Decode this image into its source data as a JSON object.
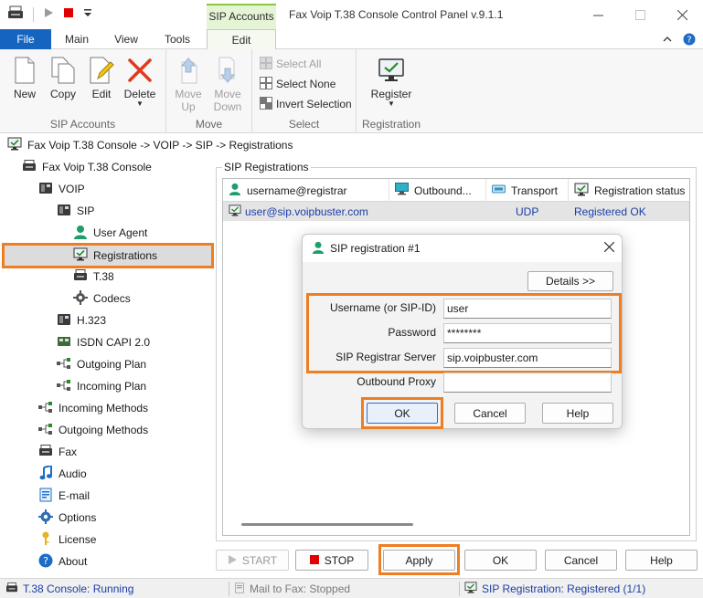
{
  "window": {
    "title": "Fax Voip T.38 Console Control Panel v.9.1.1",
    "context_tab_group": "SIP Accounts"
  },
  "ribbon": {
    "tabs": [
      "File",
      "Main",
      "View",
      "Tools",
      "Edit"
    ],
    "active_tab": "Edit",
    "groups": {
      "sip_accounts": {
        "label": "SIP Accounts",
        "new": "New",
        "copy": "Copy",
        "edit": "Edit",
        "delete": "Delete"
      },
      "move": {
        "label": "Move",
        "move_up_1": "Move",
        "move_up_2": "Up",
        "move_down_1": "Move",
        "move_down_2": "Down"
      },
      "select": {
        "label": "Select",
        "select_all": "Select All",
        "select_none": "Select None",
        "invert": "Invert Selection"
      },
      "registration": {
        "label": "Registration",
        "register": "Register"
      }
    }
  },
  "breadcrumb": "Fax Voip T.38 Console -> VOIP -> SIP -> Registrations",
  "tree": {
    "root": "Fax Voip T.38 Console",
    "voip": "VOIP",
    "sip": "SIP",
    "user_agent": "User Agent",
    "registrations": "Registrations",
    "t38": "T.38",
    "codecs": "Codecs",
    "h323": "H.323",
    "isdn": "ISDN CAPI 2.0",
    "outgoing_plan": "Outgoing Plan",
    "incoming_plan": "Incoming Plan",
    "incoming_methods": "Incoming Methods",
    "outgoing_methods": "Outgoing Methods",
    "fax": "Fax",
    "audio": "Audio",
    "email": "E-mail",
    "options": "Options",
    "license": "License",
    "about": "About"
  },
  "panel": {
    "legend": "SIP Registrations",
    "columns": [
      "username@registrar",
      "Outbound...",
      "Transport",
      "Registration status"
    ],
    "rows": [
      {
        "user": "user@sip.voipbuster.com",
        "outbound": "",
        "transport": "UDP",
        "status": "Registered OK"
      }
    ]
  },
  "dialog": {
    "title": "SIP registration #1",
    "details_button": "Details >>",
    "fields": {
      "username": {
        "label": "Username (or SIP-ID)",
        "value": "user"
      },
      "password": {
        "label": "Password",
        "value": "********"
      },
      "registrar": {
        "label": "SIP Registrar Server",
        "value": "sip.voipbuster.com"
      },
      "outbound": {
        "label": "Outbound Proxy",
        "value": ""
      }
    },
    "ok": "OK",
    "cancel": "Cancel",
    "help": "Help"
  },
  "buttons": {
    "start": "START",
    "stop": "STOP",
    "apply": "Apply",
    "ok": "OK",
    "cancel": "Cancel",
    "help": "Help"
  },
  "status": {
    "console": "T.38 Console: Running",
    "mail": "Mail to Fax: Stopped",
    "sip": "SIP Registration: Registered (1/1)"
  },
  "colors": {
    "accent_highlight": "#ef7d22",
    "file_tab": "#1565c0",
    "context_tab": "#8cc63e",
    "link_text": "#1b3ea8"
  }
}
